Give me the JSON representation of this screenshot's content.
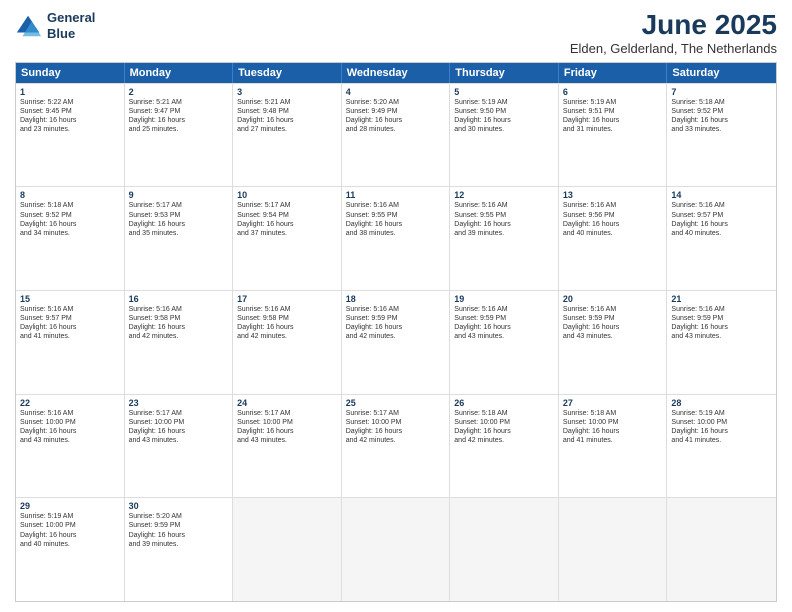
{
  "logo": {
    "line1": "General",
    "line2": "Blue"
  },
  "title": "June 2025",
  "location": "Elden, Gelderland, The Netherlands",
  "days": [
    "Sunday",
    "Monday",
    "Tuesday",
    "Wednesday",
    "Thursday",
    "Friday",
    "Saturday"
  ],
  "rows": [
    [
      {
        "day": "1",
        "lines": [
          "Sunrise: 5:22 AM",
          "Sunset: 9:45 PM",
          "Daylight: 16 hours",
          "and 23 minutes."
        ]
      },
      {
        "day": "2",
        "lines": [
          "Sunrise: 5:21 AM",
          "Sunset: 9:47 PM",
          "Daylight: 16 hours",
          "and 25 minutes."
        ]
      },
      {
        "day": "3",
        "lines": [
          "Sunrise: 5:21 AM",
          "Sunset: 9:48 PM",
          "Daylight: 16 hours",
          "and 27 minutes."
        ]
      },
      {
        "day": "4",
        "lines": [
          "Sunrise: 5:20 AM",
          "Sunset: 9:49 PM",
          "Daylight: 16 hours",
          "and 28 minutes."
        ]
      },
      {
        "day": "5",
        "lines": [
          "Sunrise: 5:19 AM",
          "Sunset: 9:50 PM",
          "Daylight: 16 hours",
          "and 30 minutes."
        ]
      },
      {
        "day": "6",
        "lines": [
          "Sunrise: 5:19 AM",
          "Sunset: 9:51 PM",
          "Daylight: 16 hours",
          "and 31 minutes."
        ]
      },
      {
        "day": "7",
        "lines": [
          "Sunrise: 5:18 AM",
          "Sunset: 9:52 PM",
          "Daylight: 16 hours",
          "and 33 minutes."
        ]
      }
    ],
    [
      {
        "day": "8",
        "lines": [
          "Sunrise: 5:18 AM",
          "Sunset: 9:52 PM",
          "Daylight: 16 hours",
          "and 34 minutes."
        ]
      },
      {
        "day": "9",
        "lines": [
          "Sunrise: 5:17 AM",
          "Sunset: 9:53 PM",
          "Daylight: 16 hours",
          "and 35 minutes."
        ]
      },
      {
        "day": "10",
        "lines": [
          "Sunrise: 5:17 AM",
          "Sunset: 9:54 PM",
          "Daylight: 16 hours",
          "and 37 minutes."
        ]
      },
      {
        "day": "11",
        "lines": [
          "Sunrise: 5:16 AM",
          "Sunset: 9:55 PM",
          "Daylight: 16 hours",
          "and 38 minutes."
        ]
      },
      {
        "day": "12",
        "lines": [
          "Sunrise: 5:16 AM",
          "Sunset: 9:55 PM",
          "Daylight: 16 hours",
          "and 39 minutes."
        ]
      },
      {
        "day": "13",
        "lines": [
          "Sunrise: 5:16 AM",
          "Sunset: 9:56 PM",
          "Daylight: 16 hours",
          "and 40 minutes."
        ]
      },
      {
        "day": "14",
        "lines": [
          "Sunrise: 5:16 AM",
          "Sunset: 9:57 PM",
          "Daylight: 16 hours",
          "and 40 minutes."
        ]
      }
    ],
    [
      {
        "day": "15",
        "lines": [
          "Sunrise: 5:16 AM",
          "Sunset: 9:57 PM",
          "Daylight: 16 hours",
          "and 41 minutes."
        ]
      },
      {
        "day": "16",
        "lines": [
          "Sunrise: 5:16 AM",
          "Sunset: 9:58 PM",
          "Daylight: 16 hours",
          "and 42 minutes."
        ]
      },
      {
        "day": "17",
        "lines": [
          "Sunrise: 5:16 AM",
          "Sunset: 9:58 PM",
          "Daylight: 16 hours",
          "and 42 minutes."
        ]
      },
      {
        "day": "18",
        "lines": [
          "Sunrise: 5:16 AM",
          "Sunset: 9:59 PM",
          "Daylight: 16 hours",
          "and 42 minutes."
        ]
      },
      {
        "day": "19",
        "lines": [
          "Sunrise: 5:16 AM",
          "Sunset: 9:59 PM",
          "Daylight: 16 hours",
          "and 43 minutes."
        ]
      },
      {
        "day": "20",
        "lines": [
          "Sunrise: 5:16 AM",
          "Sunset: 9:59 PM",
          "Daylight: 16 hours",
          "and 43 minutes."
        ]
      },
      {
        "day": "21",
        "lines": [
          "Sunrise: 5:16 AM",
          "Sunset: 9:59 PM",
          "Daylight: 16 hours",
          "and 43 minutes."
        ]
      }
    ],
    [
      {
        "day": "22",
        "lines": [
          "Sunrise: 5:16 AM",
          "Sunset: 10:00 PM",
          "Daylight: 16 hours",
          "and 43 minutes."
        ]
      },
      {
        "day": "23",
        "lines": [
          "Sunrise: 5:17 AM",
          "Sunset: 10:00 PM",
          "Daylight: 16 hours",
          "and 43 minutes."
        ]
      },
      {
        "day": "24",
        "lines": [
          "Sunrise: 5:17 AM",
          "Sunset: 10:00 PM",
          "Daylight: 16 hours",
          "and 43 minutes."
        ]
      },
      {
        "day": "25",
        "lines": [
          "Sunrise: 5:17 AM",
          "Sunset: 10:00 PM",
          "Daylight: 16 hours",
          "and 42 minutes."
        ]
      },
      {
        "day": "26",
        "lines": [
          "Sunrise: 5:18 AM",
          "Sunset: 10:00 PM",
          "Daylight: 16 hours",
          "and 42 minutes."
        ]
      },
      {
        "day": "27",
        "lines": [
          "Sunrise: 5:18 AM",
          "Sunset: 10:00 PM",
          "Daylight: 16 hours",
          "and 41 minutes."
        ]
      },
      {
        "day": "28",
        "lines": [
          "Sunrise: 5:19 AM",
          "Sunset: 10:00 PM",
          "Daylight: 16 hours",
          "and 41 minutes."
        ]
      }
    ],
    [
      {
        "day": "29",
        "lines": [
          "Sunrise: 5:19 AM",
          "Sunset: 10:00 PM",
          "Daylight: 16 hours",
          "and 40 minutes."
        ]
      },
      {
        "day": "30",
        "lines": [
          "Sunrise: 5:20 AM",
          "Sunset: 9:59 PM",
          "Daylight: 16 hours",
          "and 39 minutes."
        ]
      },
      {
        "day": "",
        "lines": []
      },
      {
        "day": "",
        "lines": []
      },
      {
        "day": "",
        "lines": []
      },
      {
        "day": "",
        "lines": []
      },
      {
        "day": "",
        "lines": []
      }
    ]
  ]
}
